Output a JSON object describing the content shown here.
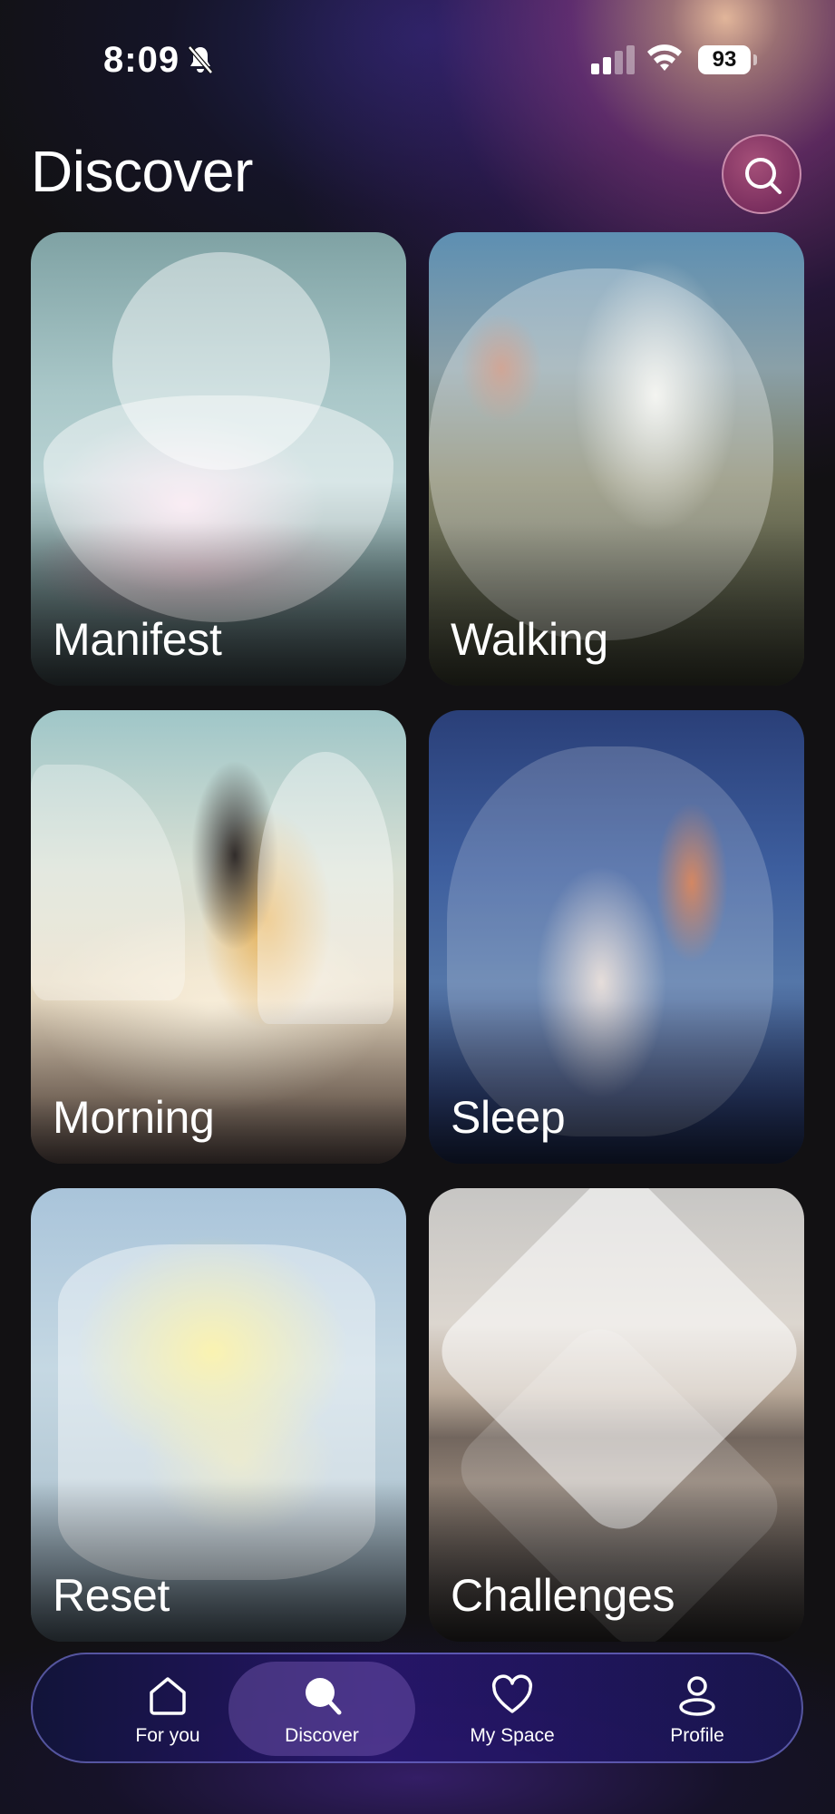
{
  "status_bar": {
    "time": "8:09",
    "battery": "93"
  },
  "header": {
    "title": "Discover"
  },
  "cards": [
    {
      "label": "Manifest"
    },
    {
      "label": "Walking"
    },
    {
      "label": "Morning"
    },
    {
      "label": "Sleep"
    },
    {
      "label": "Reset"
    },
    {
      "label": "Challenges"
    }
  ],
  "tabbar": {
    "tabs": [
      {
        "label": "For you",
        "icon": "home-icon",
        "active": false
      },
      {
        "label": "Discover",
        "icon": "search-icon",
        "active": true
      },
      {
        "label": "My Space",
        "icon": "heart-icon",
        "active": false
      },
      {
        "label": "Profile",
        "icon": "person-icon",
        "active": false
      }
    ]
  }
}
